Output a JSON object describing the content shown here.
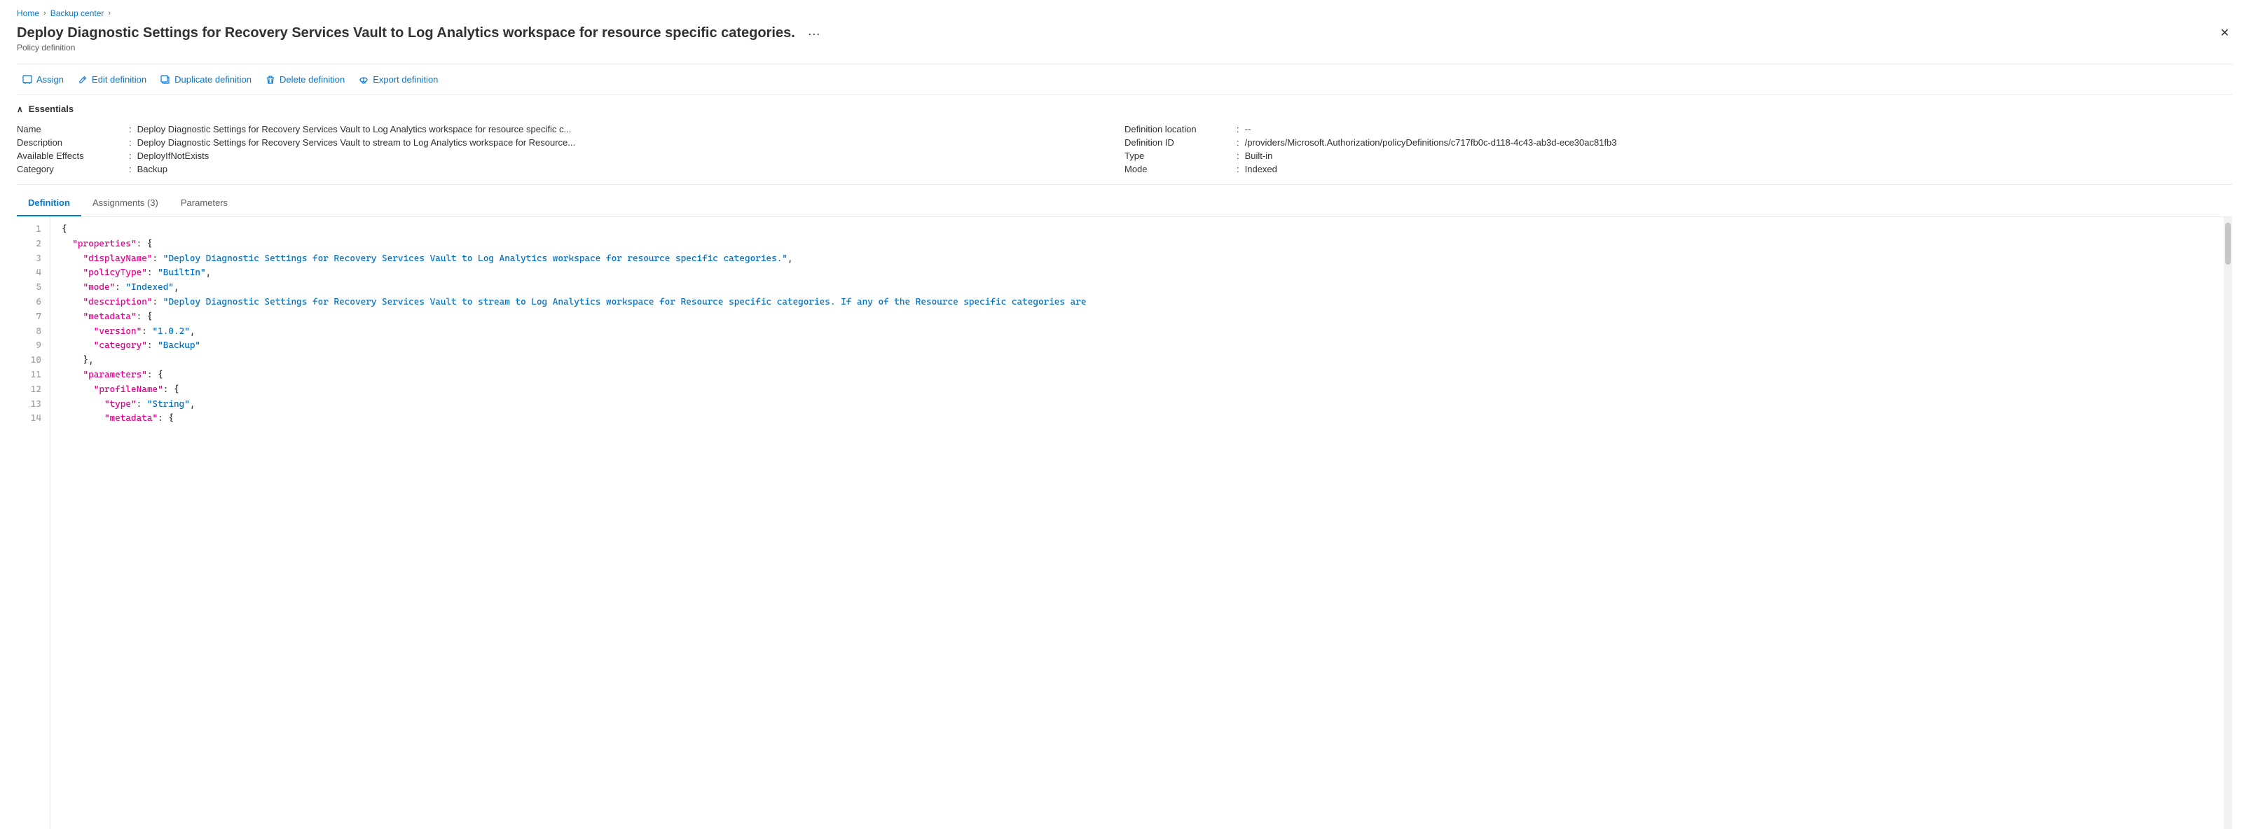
{
  "breadcrumb": {
    "home": "Home",
    "backup_center": "Backup center",
    "separator": "›"
  },
  "page": {
    "title": "Deploy Diagnostic Settings for Recovery Services Vault to Log Analytics workspace for resource specific categories.",
    "subtitle": "Policy definition",
    "menu_label": "···",
    "close_label": "✕"
  },
  "toolbar": {
    "assign_label": "Assign",
    "edit_label": "Edit definition",
    "duplicate_label": "Duplicate definition",
    "delete_label": "Delete definition",
    "export_label": "Export definition"
  },
  "essentials": {
    "header": "Essentials",
    "name_label": "Name",
    "name_value": "Deploy Diagnostic Settings for Recovery Services Vault to Log Analytics workspace for resource specific c...",
    "description_label": "Description",
    "description_value": "Deploy Diagnostic Settings for Recovery Services Vault to stream to Log Analytics workspace for Resource...",
    "available_effects_label": "Available Effects",
    "available_effects_value": "DeployIfNotExists",
    "category_label": "Category",
    "category_value": "Backup",
    "definition_location_label": "Definition location",
    "definition_location_value": "--",
    "definition_id_label": "Definition ID",
    "definition_id_value": "/providers/Microsoft.Authorization/policyDefinitions/c717fb0c-d118-4c43-ab3d-ece30ac81fb3",
    "type_label": "Type",
    "type_value": "Built-in",
    "mode_label": "Mode",
    "mode_value": "Indexed"
  },
  "tabs": [
    {
      "label": "Definition",
      "active": true
    },
    {
      "label": "Assignments (3)",
      "active": false
    },
    {
      "label": "Parameters",
      "active": false
    }
  ],
  "code_lines": [
    {
      "num": 1,
      "content": "{"
    },
    {
      "num": 2,
      "content": "  \"properties\": {"
    },
    {
      "num": 3,
      "content": "    \"displayName\": \"Deploy Diagnostic Settings for Recovery Services Vault to Log Analytics workspace for resource specific categories.\","
    },
    {
      "num": 4,
      "content": "    \"policyType\": \"BuiltIn\","
    },
    {
      "num": 5,
      "content": "    \"mode\": \"Indexed\","
    },
    {
      "num": 6,
      "content": "    \"description\": \"Deploy Diagnostic Settings for Recovery Services Vault to stream to Log Analytics workspace for Resource specific categories. If any of the Resource specific categories are"
    },
    {
      "num": 7,
      "content": "    \"metadata\": {"
    },
    {
      "num": 8,
      "content": "      \"version\": \"1.0.2\","
    },
    {
      "num": 9,
      "content": "      \"category\": \"Backup\""
    },
    {
      "num": 10,
      "content": "    },"
    },
    {
      "num": 11,
      "content": "    \"parameters\": {"
    },
    {
      "num": 12,
      "content": "      \"profileName\": {"
    },
    {
      "num": 13,
      "content": "        \"type\": \"String\","
    },
    {
      "num": 14,
      "content": "        \"metadata\": {"
    }
  ]
}
